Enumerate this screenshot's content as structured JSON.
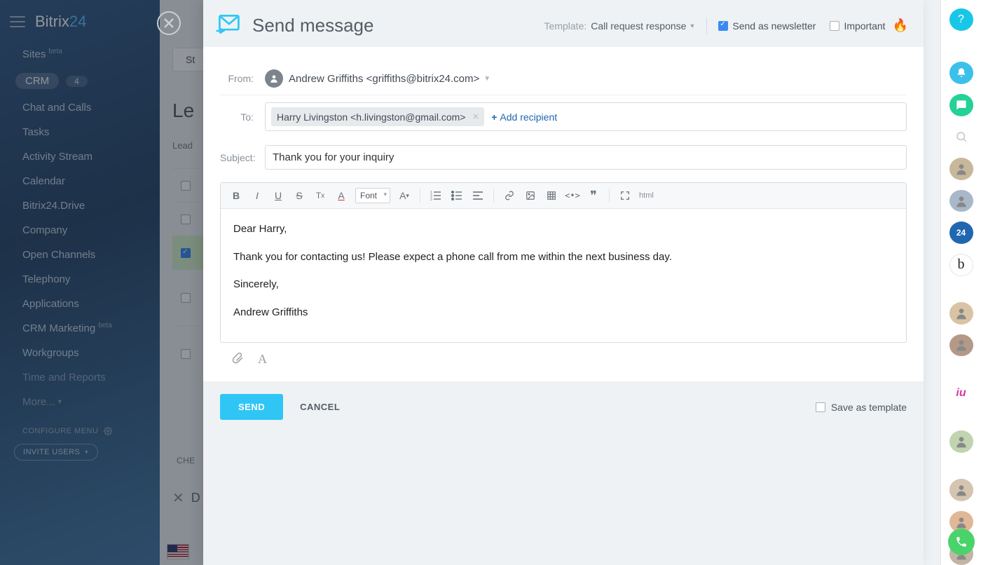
{
  "brand": {
    "name": "Bitrix",
    "suffix": "24"
  },
  "nav": {
    "items": [
      {
        "label": "Sites",
        "badge": "beta"
      },
      {
        "label": "CRM",
        "count": "4",
        "active": true
      },
      {
        "label": "Chat and Calls"
      },
      {
        "label": "Tasks"
      },
      {
        "label": "Activity Stream"
      },
      {
        "label": "Calendar"
      },
      {
        "label": "Bitrix24.Drive"
      },
      {
        "label": "Company"
      },
      {
        "label": "Open Channels"
      },
      {
        "label": "Telephony"
      },
      {
        "label": "Applications"
      },
      {
        "label": "CRM Marketing",
        "badge": "beta"
      },
      {
        "label": "Workgroups"
      },
      {
        "label": "Time and Reports"
      },
      {
        "label": "More..."
      }
    ],
    "configure": "CONFIGURE MENU",
    "invite": "INVITE USERS"
  },
  "behind": {
    "page_title": "Le",
    "tab": "St",
    "subhead": "Lead",
    "checked_label": "CHE",
    "del_char": "D"
  },
  "modal": {
    "title": "Send message",
    "template_label": "Template:",
    "template_value": "Call request response",
    "newsletter_label": "Send as newsletter",
    "newsletter_checked": true,
    "important_label": "Important",
    "important_checked": false,
    "from_label": "From:",
    "from_value": "Andrew Griffiths <griffiths@bitrix24.com>",
    "to_label": "To:",
    "to_chip": "Harry Livingston <h.livingston@gmail.com>",
    "add_recipient": "Add recipient",
    "subject_label": "Subject:",
    "subject_value": "Thank you for your inquiry",
    "font_label": "Font",
    "html_label": "html",
    "body": {
      "p1": "Dear Harry,",
      "p2": "Thank you for contacting us! Please expect a phone call from me within the next business day.",
      "p3": "Sincerely,",
      "p4": "Andrew Griffiths"
    },
    "send": "SEND",
    "cancel": "CANCEL",
    "save_template": "Save as template"
  },
  "rail": {
    "b24": "24",
    "b": "b",
    "iu": "iu"
  }
}
